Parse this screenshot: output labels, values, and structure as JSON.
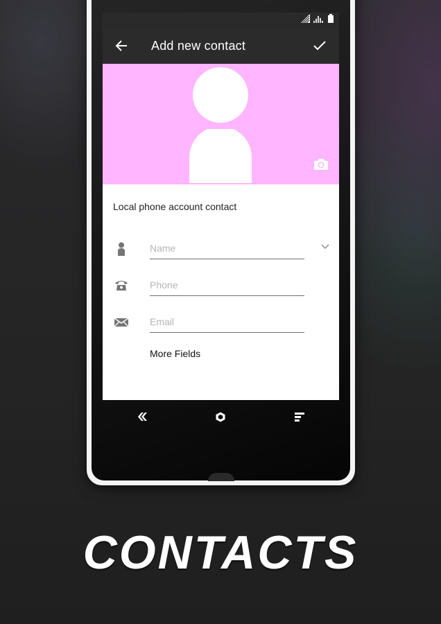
{
  "toolbar": {
    "title": "Add new contact",
    "back_icon": "arrow-left-icon",
    "done_icon": "check-icon"
  },
  "status_bar": {
    "icons": [
      "no-data-icon",
      "signal-icon",
      "battery-icon"
    ]
  },
  "photo": {
    "background_color": "#ffb5ff",
    "placeholder_icon": "person-silhouette-icon",
    "camera_icon": "camera-icon"
  },
  "form": {
    "account_label": "Local phone account contact",
    "fields": [
      {
        "icon": "person-icon",
        "placeholder": "Name",
        "value": ""
      },
      {
        "icon": "phone-icon",
        "placeholder": "Phone",
        "value": ""
      },
      {
        "icon": "email-icon",
        "placeholder": "Email",
        "value": ""
      }
    ],
    "more_fields_label": "More Fields"
  },
  "navbar": {
    "buttons": [
      "back-icon",
      "home-icon",
      "recents-icon"
    ]
  },
  "headline": "CONTACTS"
}
